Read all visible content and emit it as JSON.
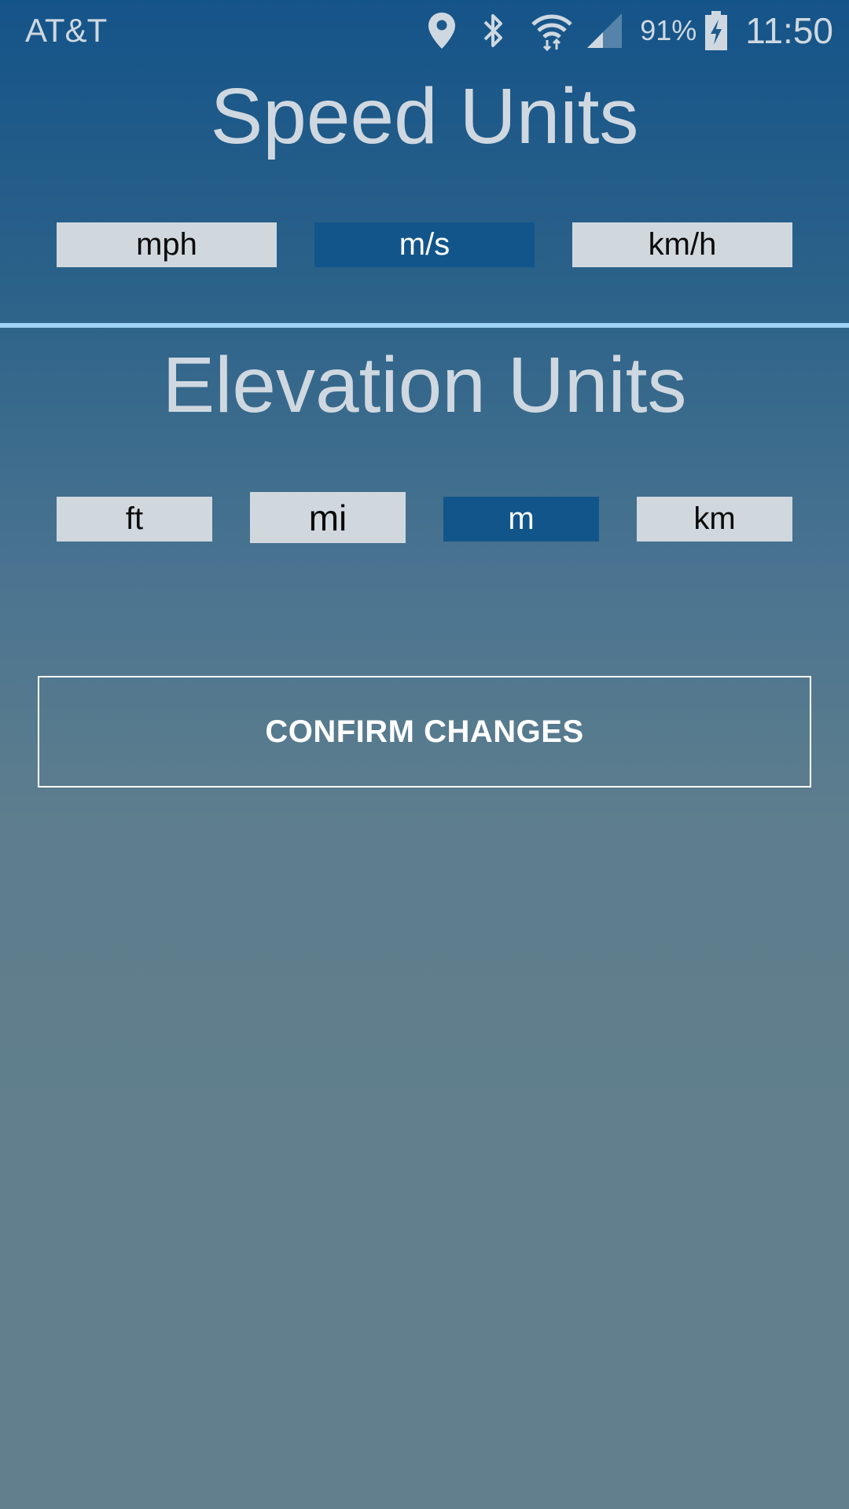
{
  "status_bar": {
    "carrier": "AT&T",
    "battery_percent": "91%",
    "time": "11:50",
    "icons": [
      "location-icon",
      "bluetooth-icon",
      "wifi-icon",
      "signal-icon",
      "battery-charging-icon"
    ]
  },
  "speed": {
    "title": "Speed Units",
    "options": [
      "mph",
      "m/s",
      "km/h"
    ],
    "selected": "m/s"
  },
  "elevation": {
    "title": "Elevation Units",
    "options": [
      "ft",
      "mi",
      "m",
      "km"
    ],
    "selected": "m"
  },
  "confirm_label": "CONFIRM CHANGES",
  "colors": {
    "selected_button": "#12558a",
    "unselected_button": "#d0d8de",
    "divider": "#9fd3f5",
    "title_text": "#cfd8e0"
  }
}
